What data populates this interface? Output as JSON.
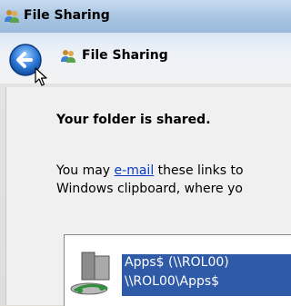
{
  "window": {
    "title": "File Sharing"
  },
  "nav": {
    "title": "File Sharing"
  },
  "main": {
    "heading": "Your folder is shared.",
    "line1_before": "You may ",
    "line1_link": "e-mail",
    "line1_after": " these links to",
    "line2": "Windows clipboard, where yo"
  },
  "share_list": {
    "items": [
      {
        "line1": "Apps$ (\\\\ROL00)",
        "line2": "\\\\ROL00\\Apps$"
      }
    ]
  },
  "colors": {
    "selection": "#2e5aa8",
    "link": "#0a3bbf"
  },
  "icons": {
    "titlebar": "users-icon",
    "nav": "users-icon",
    "back": "back-arrow-icon",
    "share": "network-share-icon"
  }
}
